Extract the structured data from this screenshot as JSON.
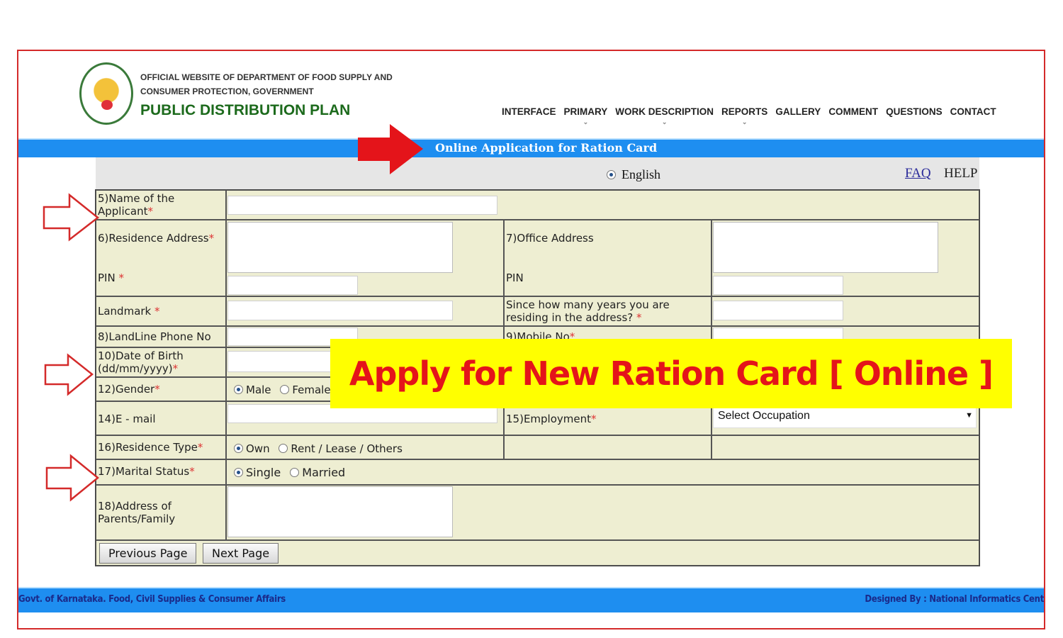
{
  "header": {
    "line1": "OFFICIAL WEBSITE OF DEPARTMENT OF FOOD SUPPLY AND",
    "line2": "CONSUMER PROTECTION, GOVERNMENT",
    "brand": "PUBLIC DISTRIBUTION PLAN"
  },
  "nav": [
    {
      "label": "INTERFACE",
      "dropdown": false
    },
    {
      "label": "PRIMARY",
      "dropdown": true
    },
    {
      "label": "WORK DESCRIPTION",
      "dropdown": true
    },
    {
      "label": "REPORTS",
      "dropdown": true
    },
    {
      "label": "GALLERY",
      "dropdown": false
    },
    {
      "label": "COMMENT",
      "dropdown": false
    },
    {
      "label": "QUESTIONS",
      "dropdown": false
    },
    {
      "label": "CONTACT",
      "dropdown": false
    }
  ],
  "page_title": "Online Application for Ration Card",
  "language": "English",
  "faq": "FAQ",
  "help": "HELP",
  "form": {
    "name": "5)Name of the Applicant",
    "residence": "6)Residence Address",
    "pin": "PIN",
    "office": "7)Office Address",
    "pin2": "PIN",
    "landmark": "Landmark",
    "years": "Since how many years you are residing in the address?",
    "landline": "8)LandLine Phone No",
    "mobile": "9)Mobile No",
    "dob": "10)Date of Birth (dd/mm/yyyy)",
    "gender": "12)Gender",
    "male": "Male",
    "female": "Female",
    "email": "14)E - mail",
    "employment": "15)Employment",
    "occupation_selected": "Select Occupation",
    "residence_type": "16)Residence Type",
    "own": "Own",
    "rent": "Rent / Lease / Others",
    "marital": "17)Marital Status",
    "single": "Single",
    "married": "Married",
    "parents": "18)Address of Parents/Family",
    "required_mark": "*"
  },
  "buttons": {
    "previous": "Previous Page",
    "next": "Next Page"
  },
  "footer": {
    "left": "Govt. of Karnataka. Food, Civil Supplies & Consumer Affairs",
    "right": "Designed By : National Informatics Cent"
  },
  "banner": "Apply for New Ration Card [ Online ]",
  "colors": {
    "bar": "#1e8ef0",
    "form_bg": "#eeeed2",
    "banner_bg": "#ffff00",
    "banner_text": "#e4141a",
    "arrow": "#e4141a"
  }
}
